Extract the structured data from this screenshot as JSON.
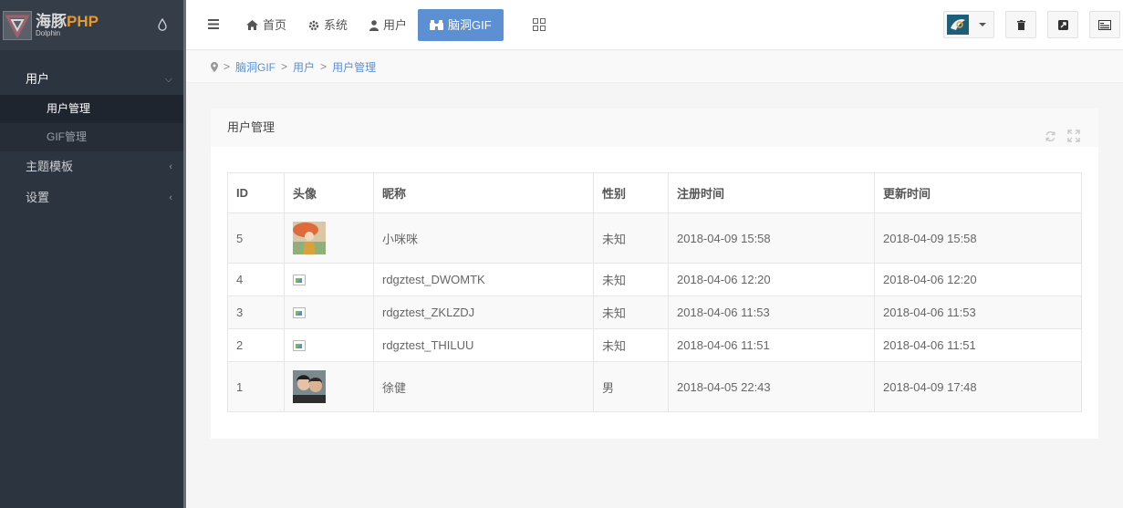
{
  "brand": {
    "name": "海豚",
    "name_suffix": "PHP",
    "sub": "Dolphin"
  },
  "sidebar": {
    "items": [
      {
        "label": "用户",
        "arrow": "⌵"
      },
      {
        "label": "主题模板",
        "arrow": "‹"
      },
      {
        "label": "设置",
        "arrow": "‹"
      }
    ],
    "sub_items": [
      {
        "label": "用户管理"
      },
      {
        "label": "GIF管理"
      }
    ]
  },
  "topnav": {
    "items": [
      {
        "label": "首页",
        "icon": "home-icon"
      },
      {
        "label": "系统",
        "icon": "gear-icon"
      },
      {
        "label": "用户",
        "icon": "user-icon"
      },
      {
        "label": "脑洞GIF",
        "icon": "binoculars-icon"
      }
    ],
    "active_color": "#5c90d2"
  },
  "breadcrumb": {
    "items": [
      "脑洞GIF",
      "用户",
      "用户管理"
    ]
  },
  "panel": {
    "title": "用户管理"
  },
  "table": {
    "headers": [
      "ID",
      "头像",
      "昵称",
      "性别",
      "注册时间",
      "更新时间"
    ],
    "rows": [
      {
        "id": "5",
        "avatar": "photo-girl",
        "nickname": "小咪咪",
        "gender": "未知",
        "created": "2018-04-09 15:58",
        "updated": "2018-04-09 15:58"
      },
      {
        "id": "4",
        "avatar": "broken",
        "nickname": "rdgztest_DWOMTK",
        "gender": "未知",
        "created": "2018-04-06 12:20",
        "updated": "2018-04-06 12:20"
      },
      {
        "id": "3",
        "avatar": "broken",
        "nickname": "rdgztest_ZKLZDJ",
        "gender": "未知",
        "created": "2018-04-06 11:53",
        "updated": "2018-04-06 11:53"
      },
      {
        "id": "2",
        "avatar": "broken",
        "nickname": "rdgztest_THILUU",
        "gender": "未知",
        "created": "2018-04-06 11:51",
        "updated": "2018-04-06 11:51"
      },
      {
        "id": "1",
        "avatar": "photo-couple",
        "nickname": "徐健",
        "gender": "男",
        "created": "2018-04-05 22:43",
        "updated": "2018-04-09 17:48"
      }
    ]
  }
}
